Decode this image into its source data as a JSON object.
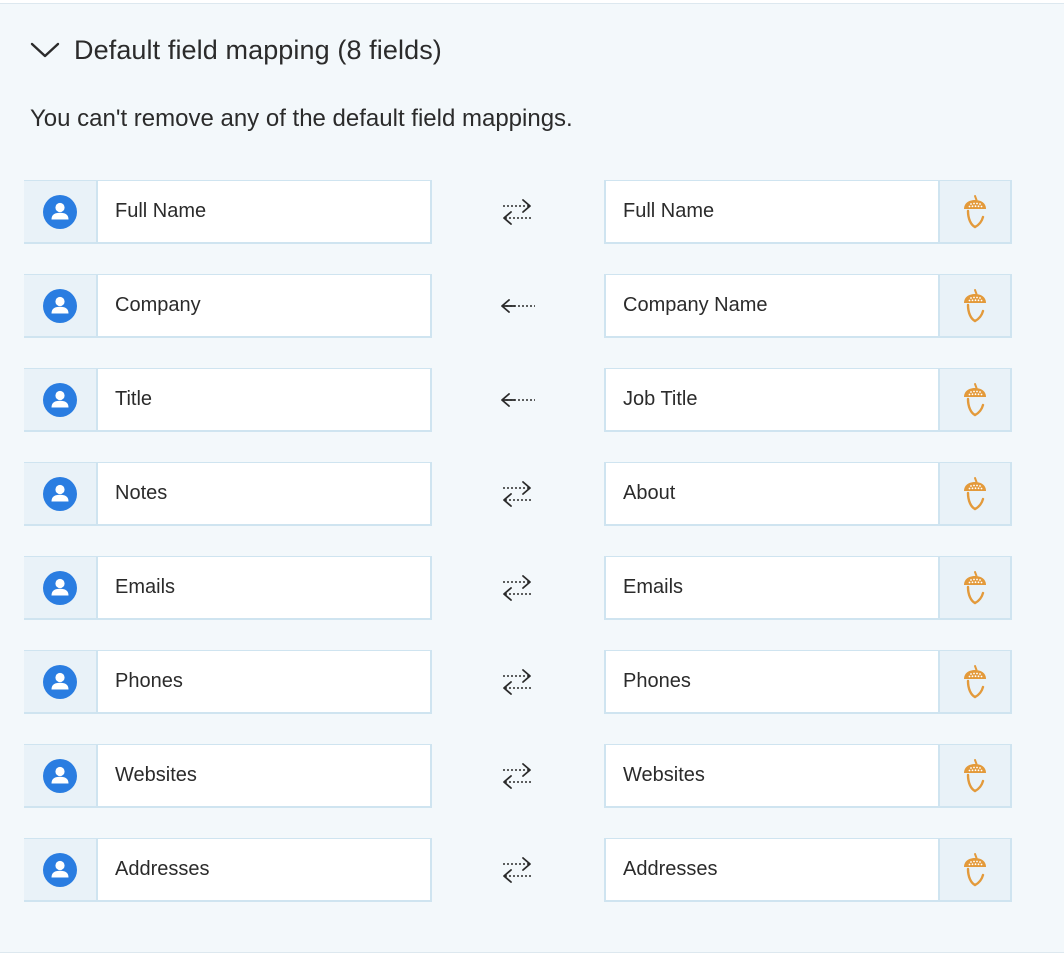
{
  "section": {
    "title": "Default field mapping (8 fields)",
    "description": "You can't remove any of the default field mappings."
  },
  "icons": {
    "left_field": "person-icon",
    "right_field": "acorn-icon",
    "bidirectional": "bidirectional-arrows-icon",
    "to_left": "arrow-left-icon",
    "collapse": "chevron-down-icon"
  },
  "colors": {
    "person_icon": "#2a7de1",
    "acorn_icon": "#e39a3b",
    "panel_bg": "#f3f8fb",
    "border": "#cfe4f0"
  },
  "mappings": [
    {
      "left": "Full Name",
      "right": "Full Name",
      "direction": "both"
    },
    {
      "left": "Company",
      "right": "Company Name",
      "direction": "left"
    },
    {
      "left": "Title",
      "right": "Job Title",
      "direction": "left"
    },
    {
      "left": "Notes",
      "right": "About",
      "direction": "both"
    },
    {
      "left": "Emails",
      "right": "Emails",
      "direction": "both"
    },
    {
      "left": "Phones",
      "right": "Phones",
      "direction": "both"
    },
    {
      "left": "Websites",
      "right": "Websites",
      "direction": "both"
    },
    {
      "left": "Addresses",
      "right": "Addresses",
      "direction": "both"
    }
  ]
}
